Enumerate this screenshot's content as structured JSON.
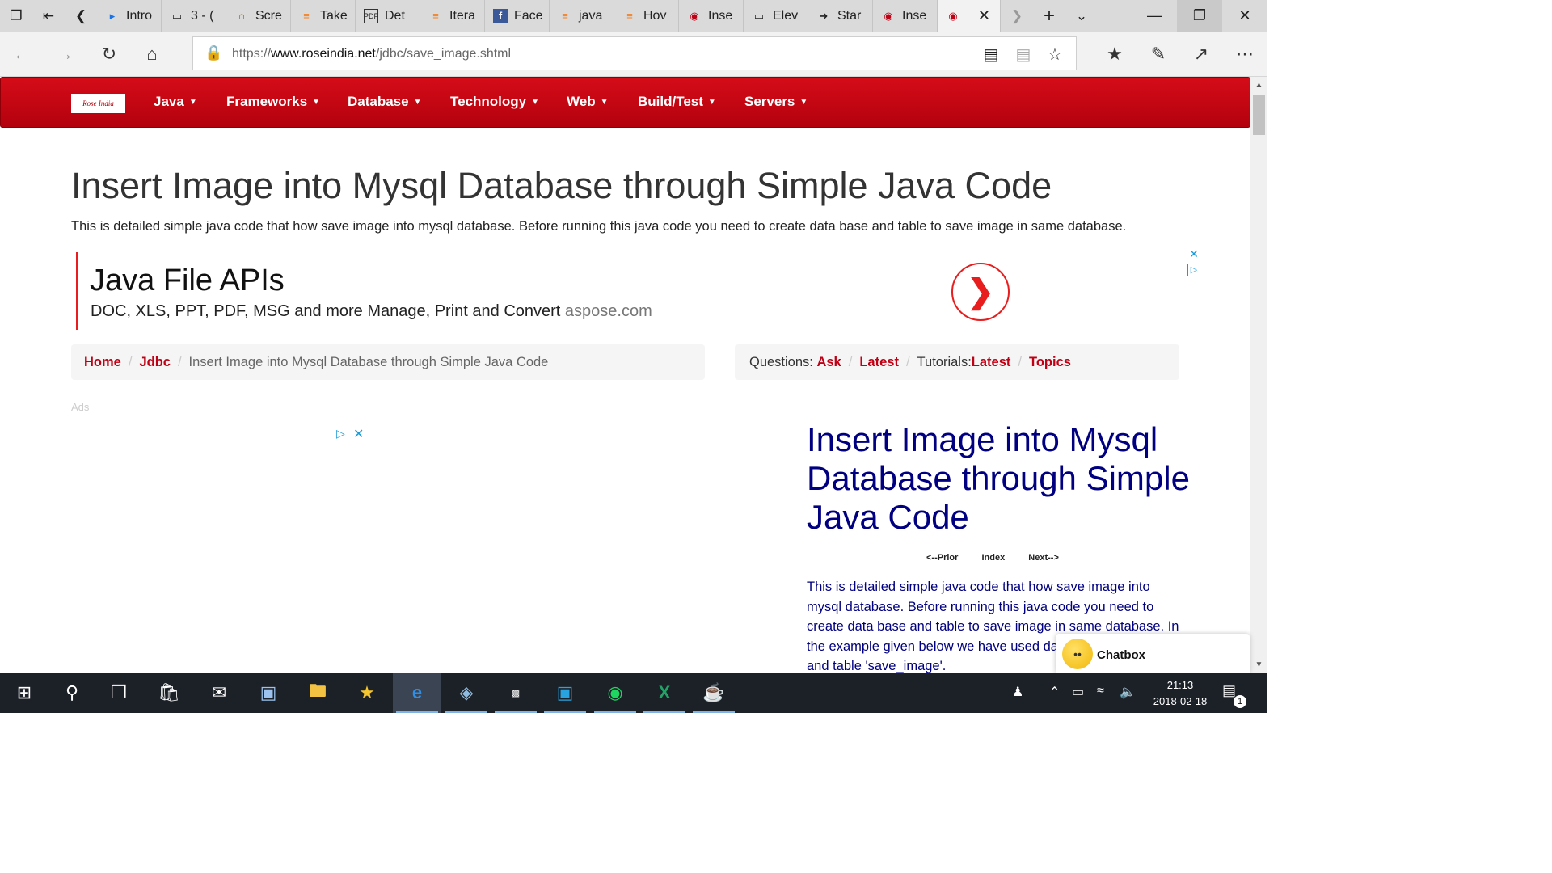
{
  "browser": {
    "tabs": [
      {
        "title": "Intro",
        "icon": "page-icon"
      },
      {
        "title": "3 - (",
        "icon": "window-icon"
      },
      {
        "title": "Scre",
        "icon": "horseshoe-icon"
      },
      {
        "title": "Take",
        "icon": "stackoverflow-icon"
      },
      {
        "title": "Det",
        "icon": "pdf-icon"
      },
      {
        "title": "Itera",
        "icon": "stackoverflow-icon"
      },
      {
        "title": "Face",
        "icon": "facebook-icon"
      },
      {
        "title": "java",
        "icon": "stackoverflow-icon"
      },
      {
        "title": "Hov",
        "icon": "stackoverflow-icon"
      },
      {
        "title": "Inse",
        "icon": "roseindia-icon"
      },
      {
        "title": "Elev",
        "icon": "window-icon"
      },
      {
        "title": "Star",
        "icon": "arrow-icon"
      },
      {
        "title": "Inse",
        "icon": "roseindia-icon"
      }
    ],
    "url_prefix": "https://",
    "url_domain": "www.roseindia.net",
    "url_path": "/jdbc/save_image.shtml"
  },
  "site": {
    "logo_text": "Rose India",
    "menu": [
      "Java",
      "Frameworks",
      "Database",
      "Technology",
      "Web",
      "Build/Test",
      "Servers"
    ]
  },
  "page": {
    "title": "Insert Image into Mysql Database through Simple Java Code",
    "description": "This is detailed simple java code that how save image into mysql database. Before running this java code you need to create data base and table to save image in same database."
  },
  "ad": {
    "title": "Java File APIs",
    "text": "DOC, XLS, PPT, PDF, MSG and more Manage, Print and Convert",
    "domain": "aspose.com"
  },
  "breadcrumb": {
    "home": "Home",
    "section": "Jdbc",
    "current": "Insert Image into Mysql Database through Simple Java Code"
  },
  "quicklinks": {
    "questions_label": "Questions:",
    "ask": "Ask",
    "latest": "Latest",
    "tutorials_label": "Tutorials:",
    "tutorials_latest": "Latest",
    "topics": "Topics"
  },
  "ads_label": "Ads",
  "article": {
    "title": "Insert Image into Mysql Database through Simple Java Code",
    "prior": "<--Prior",
    "index": "Index",
    "next": "Next-->",
    "text": "This is detailed simple java code that how save image into mysql database. Before running this java code you need to create data base and table to save image in same database. In the example given below we have used database 'mahendra' and table 'save_image'."
  },
  "chatbox": {
    "label": "Chatbox"
  },
  "taskbar": {
    "time": "21:13",
    "date": "2018-02-18",
    "notification_count": "1"
  },
  "colors": {
    "brand_red": "#c00015",
    "article_blue": "#000080",
    "ad_red": "#e81e1e"
  }
}
